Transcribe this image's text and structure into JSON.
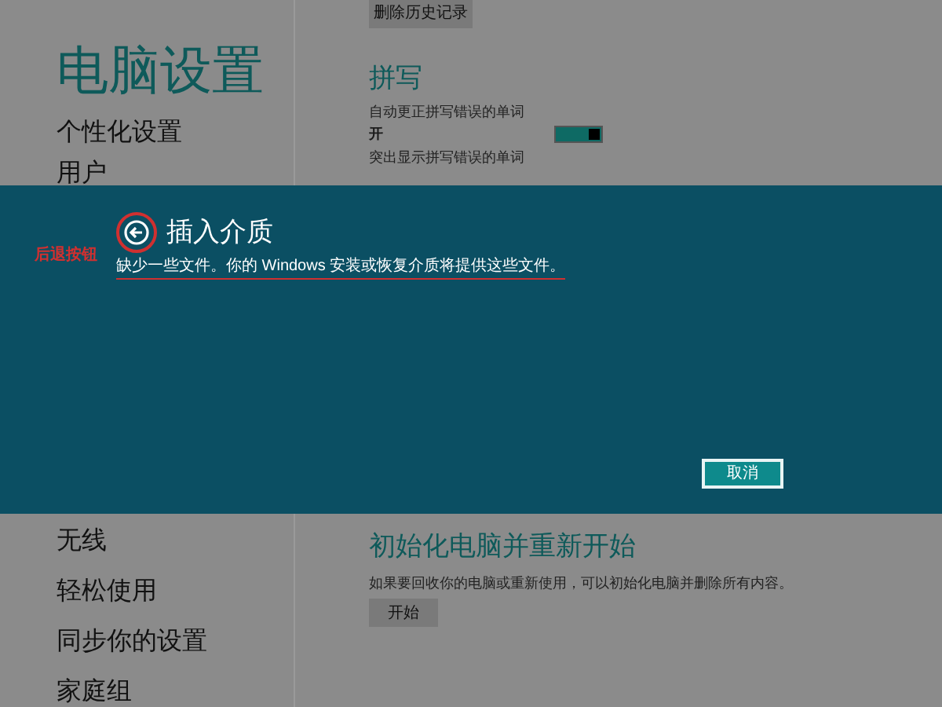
{
  "sidebar": {
    "title": "电脑设置",
    "items_above": [
      {
        "label": "个性化设置"
      },
      {
        "label": "用户"
      }
    ],
    "items_below": [
      {
        "label": "无线"
      },
      {
        "label": "轻松使用"
      },
      {
        "label": "同步你的设置"
      },
      {
        "label": "家庭组"
      }
    ]
  },
  "content_top": {
    "clear_history_button": "删除历史记录",
    "heading": "拼写",
    "autocorrect": {
      "label": "自动更正拼写错误的单词",
      "value": "开",
      "on": true
    },
    "highlight_label": "突出显示拼写错误的单词"
  },
  "dialog": {
    "title": "插入介质",
    "message": "缺少一些文件。你的 Windows 安装或恢复介质将提供这些文件。",
    "cancel_button": "取消"
  },
  "annotation": {
    "label": "后退按钮"
  },
  "content_bottom": {
    "heading": "初始化电脑并重新开始",
    "description": "如果要回收你的电脑或重新使用，可以初始化电脑并删除所有内容。",
    "start_button": "开始"
  }
}
